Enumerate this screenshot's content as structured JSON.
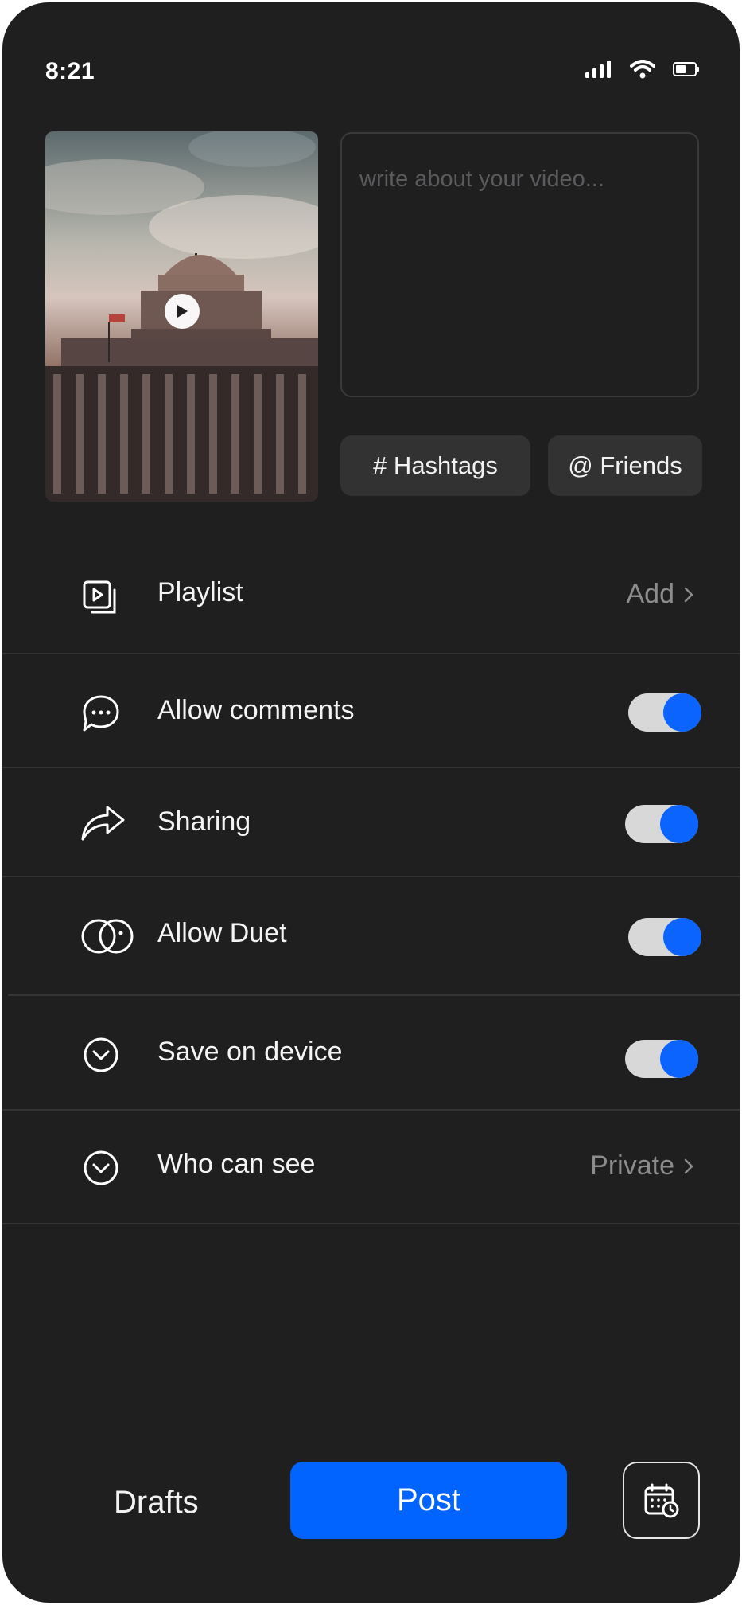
{
  "status_bar": {
    "time": "8:21",
    "icons": [
      "cellular-signal-icon",
      "wifi-icon",
      "battery-icon"
    ]
  },
  "composer": {
    "caption_placeholder": "write about your video...",
    "hashtags_label": "# Hashtags",
    "friends_label": "@ Friends"
  },
  "settings": {
    "playlist": {
      "label": "Playlist",
      "value": "Add"
    },
    "comments": {
      "label": "Allow comments",
      "enabled": true
    },
    "sharing": {
      "label": "Sharing",
      "enabled": true
    },
    "duet": {
      "label": "Allow Duet",
      "enabled": true
    },
    "save": {
      "label": "Save on device",
      "enabled": true
    },
    "visibility": {
      "label": "Who can see",
      "value": "Private"
    }
  },
  "actions": {
    "drafts_label": "Drafts",
    "post_label": "Post"
  },
  "colors": {
    "background": "#1f1f20",
    "accent": "#0264fe",
    "toggle_track": "#d8d8d8"
  }
}
